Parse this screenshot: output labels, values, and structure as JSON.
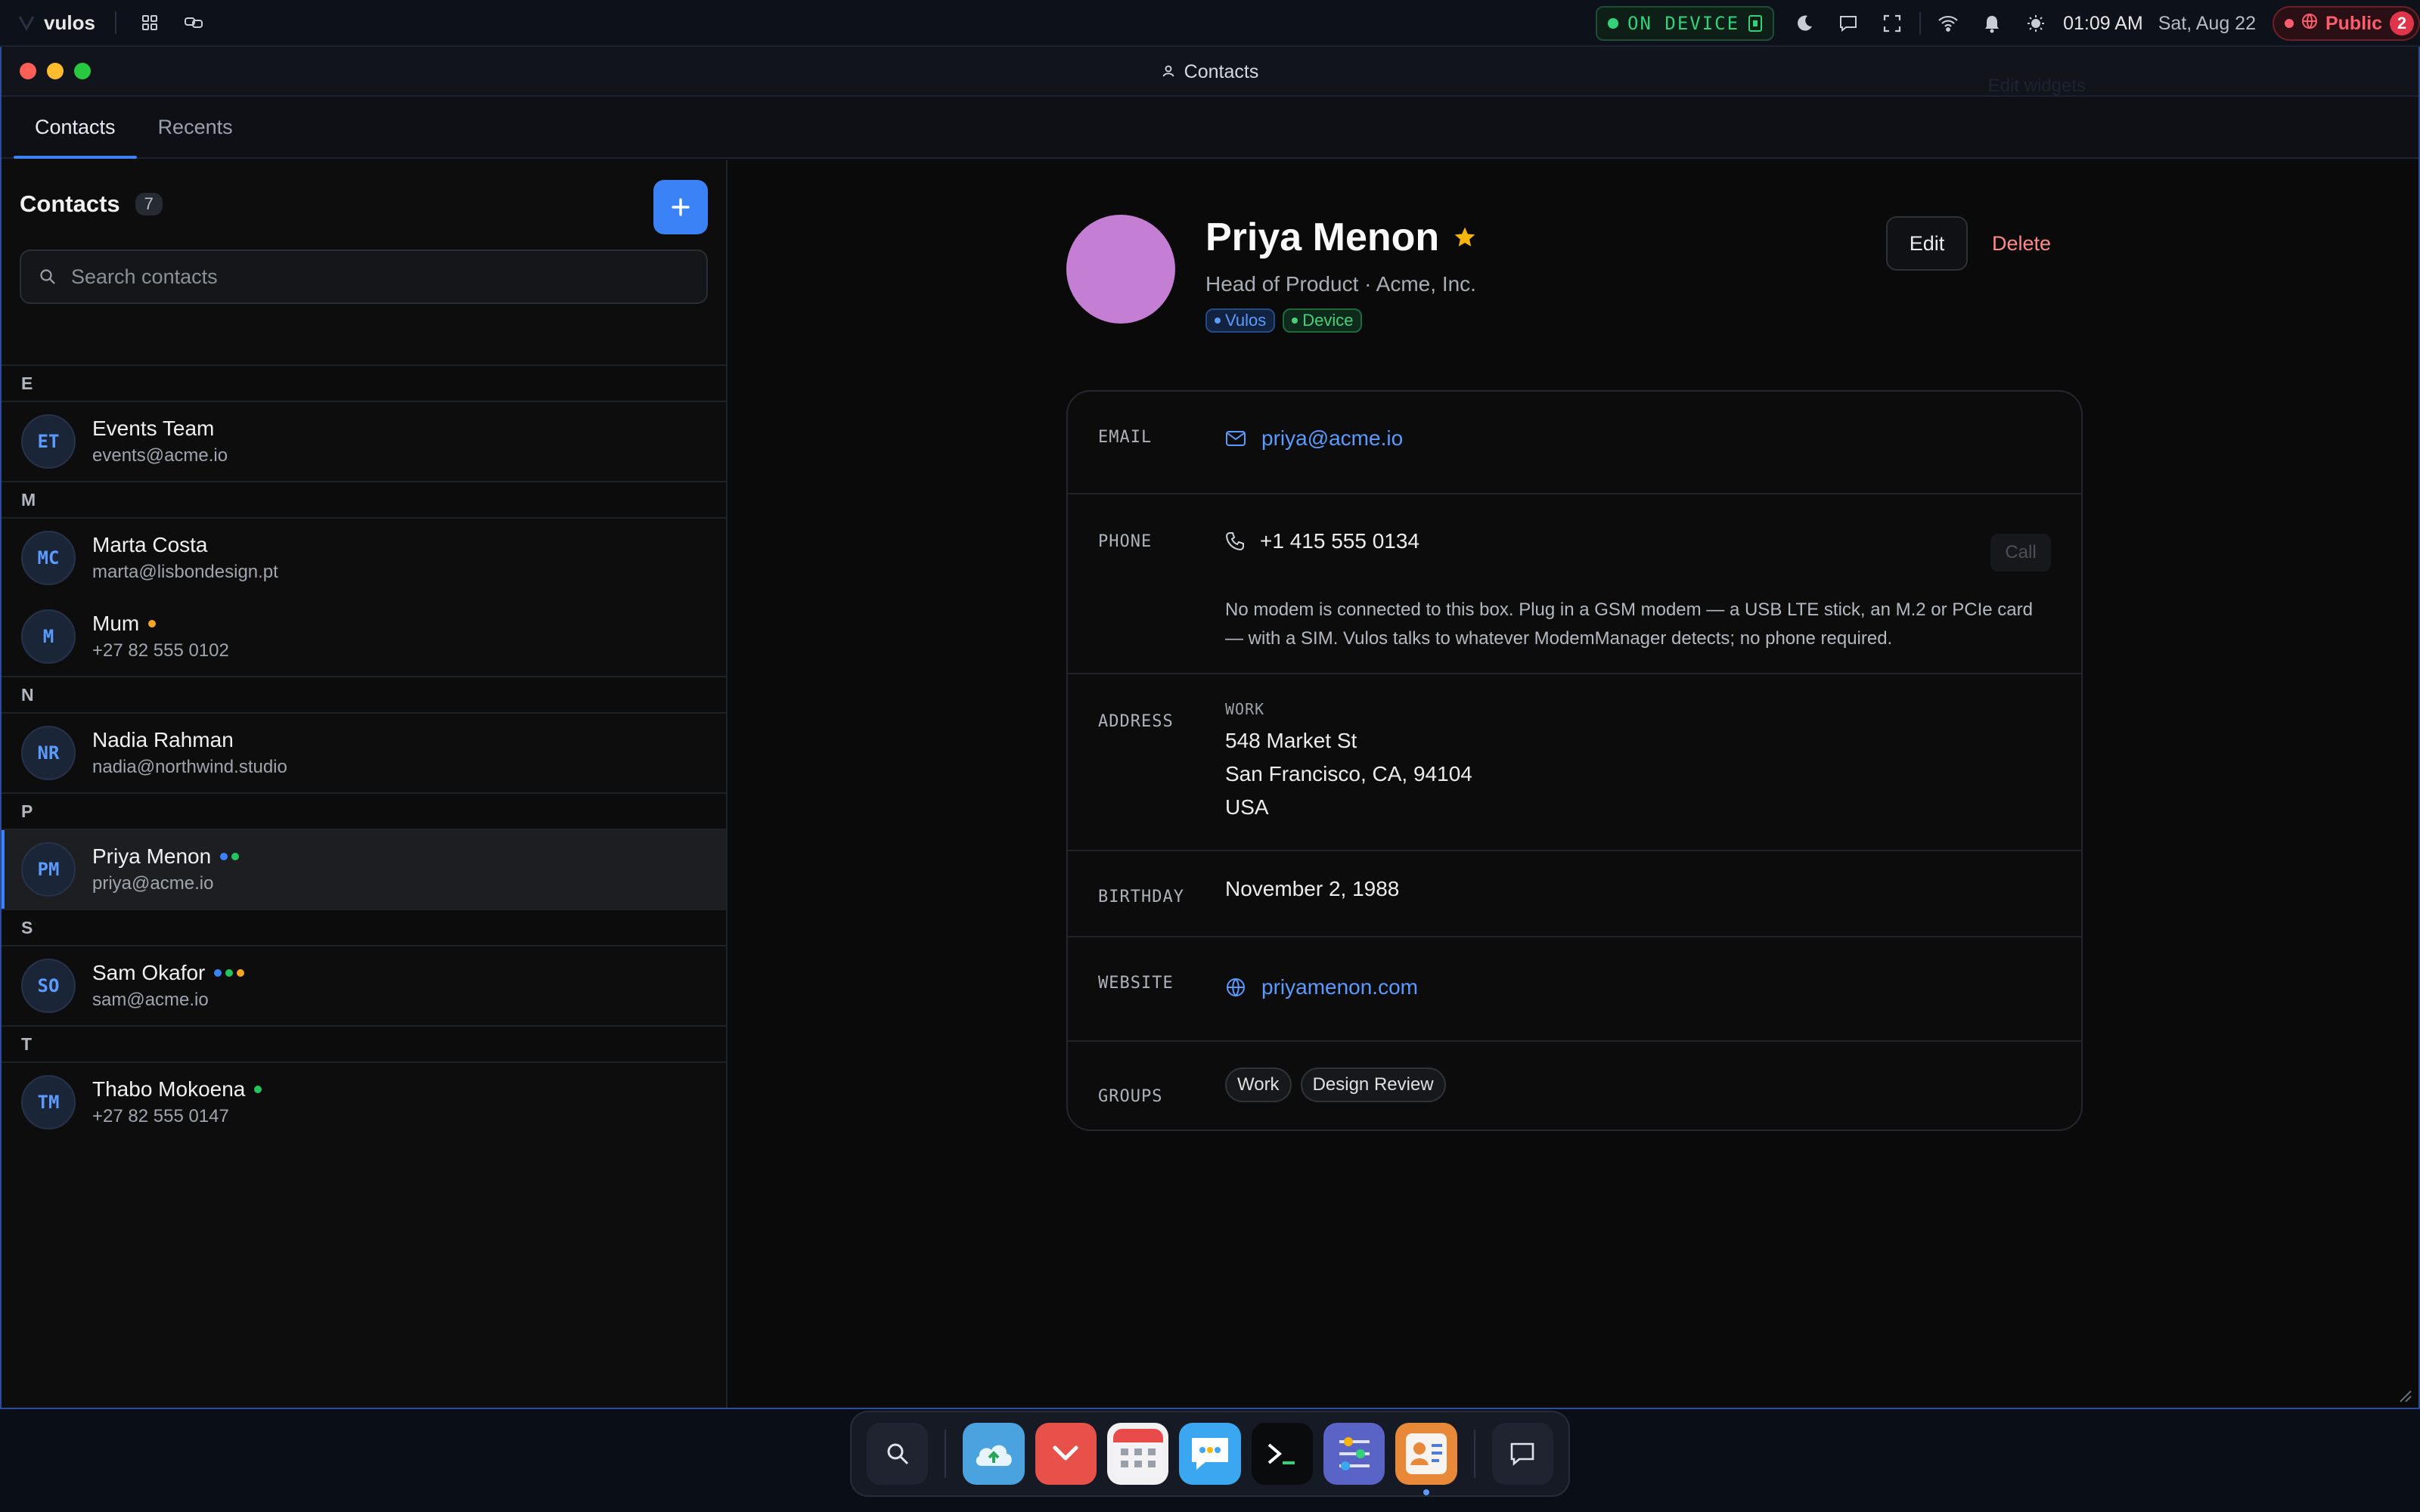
{
  "topbar": {
    "brand": "vulos",
    "device_label": "ON DEVICE",
    "time": "01:09 AM",
    "date": "Sat, Aug 22",
    "public_label": "Public",
    "public_count": "2"
  },
  "window": {
    "title": "Contacts",
    "edit_widgets": "Edit widgets",
    "tabs": [
      "Contacts",
      "Recents"
    ]
  },
  "sidebar": {
    "title": "Contacts",
    "count": "7",
    "search_placeholder": "Search contacts",
    "sections": [
      {
        "letter": "E",
        "contacts": [
          {
            "initials": "ET",
            "name": "Events Team",
            "sub": "events@acme.io",
            "dots": []
          }
        ]
      },
      {
        "letter": "M",
        "contacts": [
          {
            "initials": "MC",
            "name": "Marta Costa",
            "sub": "marta@lisbondesign.pt",
            "dots": []
          },
          {
            "initials": "M",
            "name": "Mum",
            "sub": "+27 82 555 0102",
            "dots": [
              "#f5a524"
            ]
          }
        ]
      },
      {
        "letter": "N",
        "contacts": [
          {
            "initials": "NR",
            "name": "Nadia Rahman",
            "sub": "nadia@northwind.studio",
            "dots": []
          }
        ]
      },
      {
        "letter": "P",
        "contacts": [
          {
            "initials": "PM",
            "name": "Priya Menon",
            "sub": "priya@acme.io",
            "dots": [
              "#3b82f6",
              "#22c55e"
            ],
            "selected": true
          }
        ]
      },
      {
        "letter": "S",
        "contacts": [
          {
            "initials": "SO",
            "name": "Sam Okafor",
            "sub": "sam@acme.io",
            "dots": [
              "#3b82f6",
              "#22c55e",
              "#f5a524"
            ]
          }
        ]
      },
      {
        "letter": "T",
        "contacts": [
          {
            "initials": "TM",
            "name": "Thabo Mokoena",
            "sub": "+27 82 555 0147",
            "dots": [
              "#22c55e"
            ]
          }
        ]
      }
    ]
  },
  "detail": {
    "name": "Priya Menon",
    "subtitle": "Head of Product · Acme, Inc.",
    "tags": [
      "Vulos",
      "Device"
    ],
    "edit_label": "Edit",
    "delete_label": "Delete",
    "email_label": "EMAIL",
    "email": "priya@acme.io",
    "phone_label": "PHONE",
    "phone": "+1 415 555 0134",
    "call_label": "Call",
    "modem_note": "No modem is connected to this box. Plug in a GSM modem — a USB LTE stick, an M.2 or PCIe card — with a SIM. Vulos talks to whatever ModemManager detects; no phone required.",
    "address_label": "ADDRESS",
    "address_kind": "WORK",
    "address_lines": [
      "548 Market St",
      "San Francisco, CA, 94104",
      "USA"
    ],
    "birthday_label": "BIRTHDAY",
    "birthday": "November 2, 1988",
    "website_label": "WEBSITE",
    "website": "priyamenon.com",
    "groups_label": "GROUPS",
    "groups": [
      "Work",
      "Design Review"
    ]
  },
  "colors": {
    "accent": "#3b82f6",
    "avatar": "#c47fd5",
    "star": "#f5b50a",
    "danger": "#ff8a8a"
  },
  "dock": [
    "search-icon",
    "cloud-upload-icon",
    "pocket-icon",
    "calendar-icon",
    "messages-icon",
    "terminal-icon",
    "settings-sliders-icon",
    "contacts-icon",
    "chat-icon"
  ]
}
